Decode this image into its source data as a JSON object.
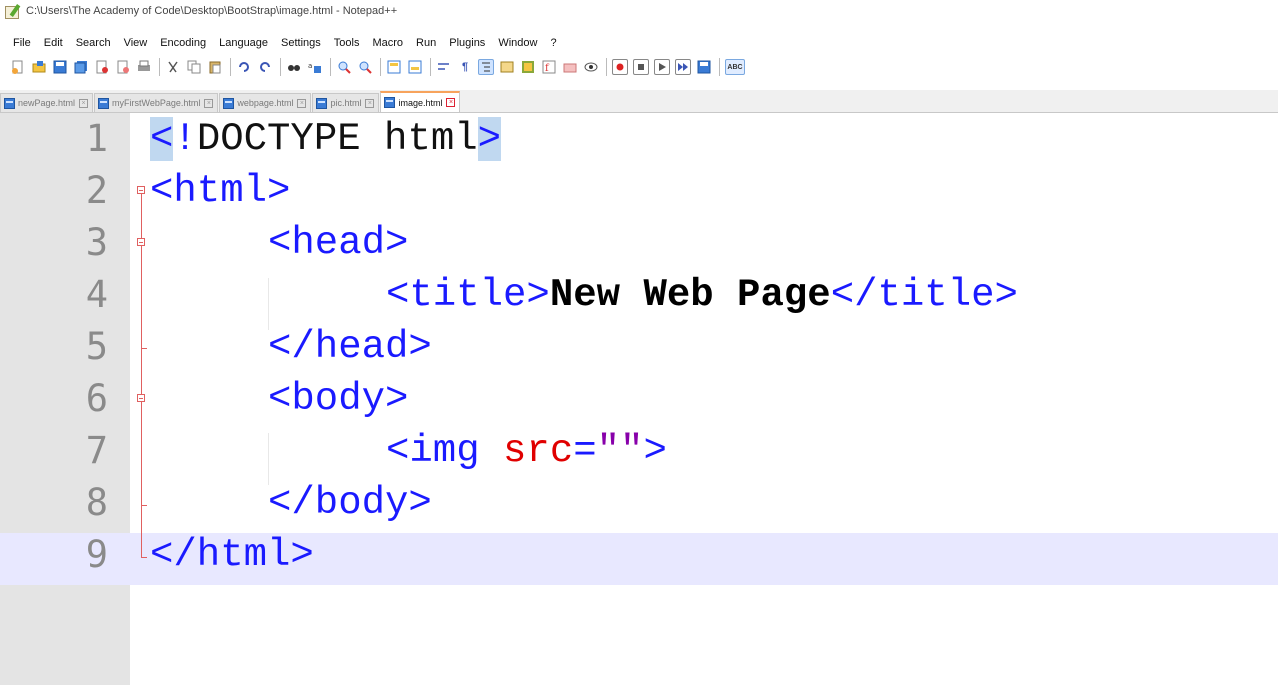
{
  "window": {
    "title": "C:\\Users\\The Academy of Code\\Desktop\\BootStrap\\image.html - Notepad++"
  },
  "menu": [
    "File",
    "Edit",
    "Search",
    "View",
    "Encoding",
    "Language",
    "Settings",
    "Tools",
    "Macro",
    "Run",
    "Plugins",
    "Window",
    "?"
  ],
  "toolbar": {
    "buttons": [
      "new-file-icon",
      "open-file-icon",
      "save-icon",
      "save-all-icon",
      "close-icon",
      "close-all-icon",
      "print-icon",
      "cut-icon",
      "copy-icon",
      "paste-icon",
      "undo-icon",
      "redo-icon",
      "find-icon",
      "replace-icon",
      "zoom-in-icon",
      "zoom-out-icon",
      "sync-vertical-icon",
      "sync-horizontal-icon",
      "word-wrap-icon",
      "show-all-chars-icon",
      "indent-guide-icon",
      "user-language-icon",
      "document-map-icon",
      "function-list-icon",
      "folder-workspace-icon",
      "monitoring-icon",
      "record-macro-icon",
      "stop-record-icon",
      "play-macro-icon",
      "run-macro-multiple-icon",
      "save-macro-icon",
      "spell-check-icon"
    ],
    "spell_check_label": "ABC"
  },
  "tabs": [
    {
      "label": "newPage.html",
      "active": false
    },
    {
      "label": "myFirstWebPage.html",
      "active": false
    },
    {
      "label": "webpage.html",
      "active": false
    },
    {
      "label": "pic.html",
      "active": false
    },
    {
      "label": "image.html",
      "active": true
    }
  ],
  "editor": {
    "line_numbers": [
      "1",
      "2",
      "3",
      "4",
      "5",
      "6",
      "7",
      "8",
      "9"
    ],
    "current_line": "9",
    "lines": {
      "l1": {
        "lt": "<",
        "bang": "!",
        "rest": "DOCTYPE html",
        "gt": ">"
      },
      "l2": {
        "text": "<html>"
      },
      "l3": {
        "text": "<head>"
      },
      "l4": {
        "open": "<title>",
        "content": "New Web Page",
        "close": "</title>"
      },
      "l5": {
        "text": "</head>"
      },
      "l6": {
        "text": "<body>"
      },
      "l7": {
        "open": "<img ",
        "attr": "src",
        "eq": "=",
        "value": "\"\"",
        "close": ">"
      },
      "l8": {
        "text": "</body>"
      },
      "l9": {
        "text": "</html>"
      }
    }
  },
  "colors": {
    "tag": "#1a1aff",
    "attribute": "#e00000",
    "current_line_bg": "#e8e8ff",
    "brace_highlight": "#c0d8f0",
    "fold_marker": "#e06060",
    "active_tab_accent": "#f7a35c"
  }
}
